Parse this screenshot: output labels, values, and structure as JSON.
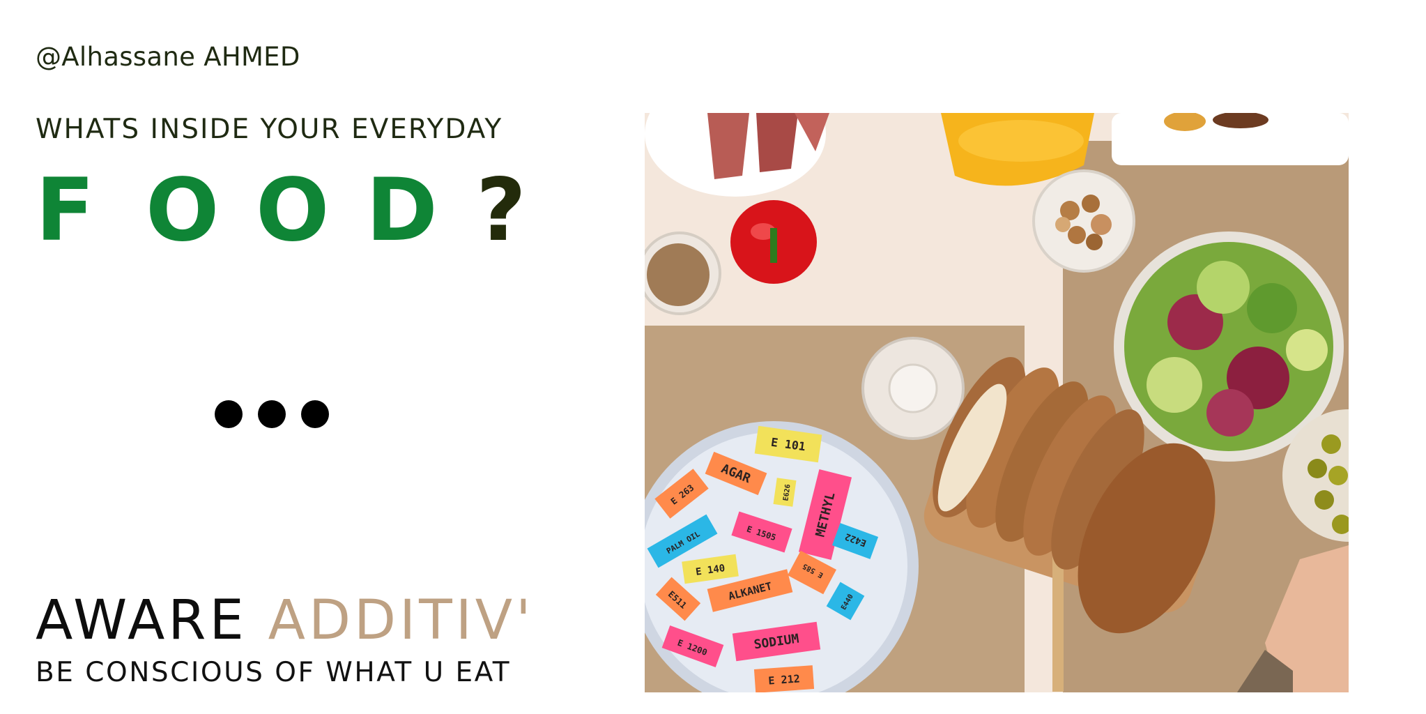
{
  "author": "@Alhassane AHMED",
  "kicker": "WHATS INSIDE YOUR EVERYDAY",
  "food_letters": [
    "F",
    "O",
    "O",
    "D"
  ],
  "question_mark": "?",
  "brand": {
    "word1": "AWARE",
    "word2": "ADDITIV'"
  },
  "tagline": "BE CONSCIOUS OF WHAT U EAT",
  "photo": {
    "additive_tags": [
      {
        "label": "E 101",
        "color": "#f2e15a"
      },
      {
        "label": "AGAR",
        "color": "#ff8a4b"
      },
      {
        "label": "E 263",
        "color": "#ff8a4b"
      },
      {
        "label": "E626",
        "color": "#f2e15a"
      },
      {
        "label": "METHYL",
        "color": "#ff4f8b"
      },
      {
        "label": "PALM OIL",
        "color": "#2bb7e6"
      },
      {
        "label": "E 1505",
        "color": "#ff4f8b"
      },
      {
        "label": "E422",
        "color": "#2bb7e6"
      },
      {
        "label": "E 140",
        "color": "#f2e15a"
      },
      {
        "label": "E 585",
        "color": "#ff8a4b"
      },
      {
        "label": "E511",
        "color": "#ff8a4b"
      },
      {
        "label": "ALKANET",
        "color": "#ff8a4b"
      },
      {
        "label": "E440",
        "color": "#2bb7e6"
      },
      {
        "label": "SODIUM",
        "color": "#ff4f8b"
      },
      {
        "label": "E 1200",
        "color": "#ff4f8b"
      },
      {
        "label": "E 212",
        "color": "#ff8a4b"
      }
    ]
  }
}
